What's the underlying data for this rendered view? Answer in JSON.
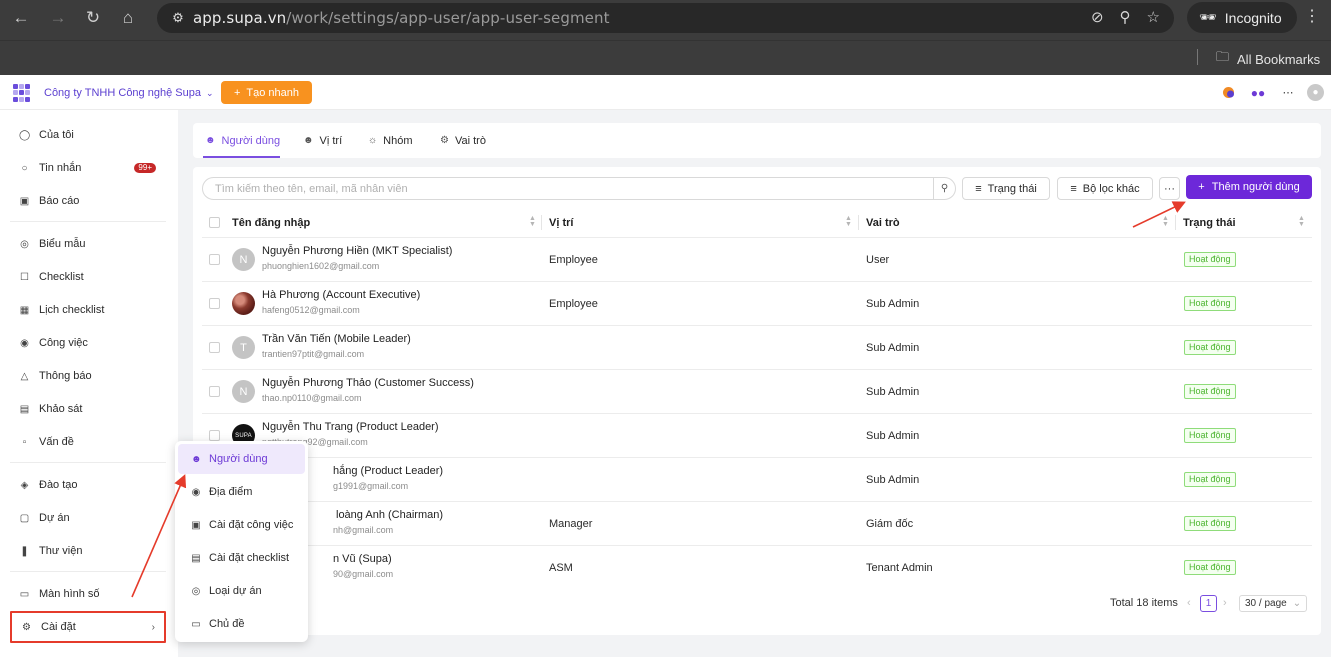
{
  "browser": {
    "url_host": "app.supa.vn",
    "url_path": "/work/settings/app-user/app-user-segment",
    "profile_label": "Incognito",
    "bookmarks_label": "All Bookmarks"
  },
  "header": {
    "company": "Công ty TNHH Công nghệ Supa",
    "quick_create": "Tạo nhanh"
  },
  "sidebar": {
    "items": [
      {
        "label": "Của tôi",
        "icon": "user-icon"
      },
      {
        "label": "Tin nhắn",
        "icon": "chat-icon",
        "badge": "99+"
      },
      {
        "label": "Báo cáo",
        "icon": "report-icon"
      },
      {
        "label": "Biểu mẫu",
        "icon": "form-icon"
      },
      {
        "label": "Checklist",
        "icon": "checklist-icon"
      },
      {
        "label": "Lịch checklist",
        "icon": "calendar-icon"
      },
      {
        "label": "Công việc",
        "icon": "task-icon"
      },
      {
        "label": "Thông báo",
        "icon": "bell-icon"
      },
      {
        "label": "Khảo sát",
        "icon": "survey-icon"
      },
      {
        "label": "Vấn đề",
        "icon": "issue-icon"
      },
      {
        "label": "Đào tạo",
        "icon": "training-icon"
      },
      {
        "label": "Dự án",
        "icon": "project-icon"
      },
      {
        "label": "Thư viện",
        "icon": "library-icon"
      },
      {
        "label": "Màn hình số",
        "icon": "monitor-icon"
      },
      {
        "label": "Cài đặt",
        "icon": "settings-icon"
      }
    ]
  },
  "tabs": [
    {
      "label": "Người dùng"
    },
    {
      "label": "Vị trí"
    },
    {
      "label": "Nhóm"
    },
    {
      "label": "Vai trò"
    }
  ],
  "toolbar": {
    "search_placeholder": "Tìm kiếm theo tên, email, mã nhân viên",
    "status_filter": "Trạng thái",
    "other_filter": "Bộ lọc khác",
    "more": "···",
    "add_user": "Thêm người dùng"
  },
  "table": {
    "columns": [
      "Tên đăng nhập",
      "Vị trí",
      "Vai trò",
      "Trạng thái"
    ],
    "rows": [
      {
        "avatar": "N",
        "name": "Nguyễn Phương Hiền (MKT Specialist)",
        "email": "phuonghien1602@gmail.com",
        "position": "Employee",
        "role": "User",
        "status": "Hoạt động"
      },
      {
        "avatar": "",
        "name": "Hà Phương (Account Executive)",
        "email": "hafeng0512@gmail.com",
        "position": "Employee",
        "role": "Sub Admin",
        "status": "Hoạt động"
      },
      {
        "avatar": "T",
        "name": "Trần Văn Tiến (Mobile Leader)",
        "email": "trantien97ptit@gmail.com",
        "position": "",
        "role": "Sub Admin",
        "status": "Hoạt động"
      },
      {
        "avatar": "N",
        "name": "Nguyễn Phương Thảo (Customer Success)",
        "email": "thao.np0110@gmail.com",
        "position": "",
        "role": "Sub Admin",
        "status": "Hoạt động"
      },
      {
        "avatar": "SUPA",
        "name": "Nguyễn Thu Trang (Product Leader)",
        "email": "ngtthutrang92@gmail.com",
        "position": "",
        "role": "Sub Admin",
        "status": "Hoạt động"
      },
      {
        "avatar": "",
        "name": "hắng (Product Leader)",
        "email": "g1991@gmail.com",
        "position": "",
        "role": "Sub Admin",
        "status": "Hoạt động"
      },
      {
        "avatar": "",
        "name": "loàng Anh (Chairman)",
        "email": "nh@gmail.com",
        "position": "Manager",
        "role": "Giám đốc",
        "status": "Hoạt động"
      },
      {
        "avatar": "",
        "name": "n Vũ (Supa)",
        "email": "90@gmail.com",
        "position": "ASM",
        "role": "Tenant Admin",
        "status": "Hoạt động"
      }
    ]
  },
  "pagination": {
    "total": "Total 18 items",
    "current_page": "1",
    "page_size": "30 / page"
  },
  "settings_menu": {
    "items": [
      {
        "label": "Người dùng",
        "icon": "users-icon"
      },
      {
        "label": "Địa điểm",
        "icon": "location-icon"
      },
      {
        "label": "Cài đặt công việc",
        "icon": "task-settings-icon"
      },
      {
        "label": "Cài đặt checklist",
        "icon": "checklist-settings-icon"
      },
      {
        "label": "Loại dự án",
        "icon": "project-type-icon"
      },
      {
        "label": "Chủ đề",
        "icon": "topic-icon"
      }
    ]
  },
  "colors": {
    "brand_purple": "#6d28d9",
    "quick_orange": "#f8921f",
    "status_green": "#4bb52e",
    "annotation_red": "#e53b2b"
  }
}
